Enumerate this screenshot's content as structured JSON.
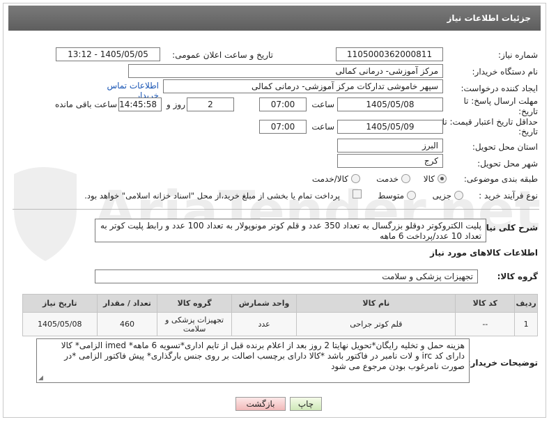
{
  "header": {
    "title": "جزئیات اطلاعات نیاز"
  },
  "watermark": {
    "text": "AriaTender.net"
  },
  "form": {
    "need_number_label": "شماره نیاز:",
    "need_number": "1105000362000811",
    "announce_label": "تاریخ و ساعت اعلان عمومی:",
    "announce_value": "1405/05/05 - 13:12",
    "buyer_org_label": "نام دستگاه خریدار:",
    "buyer_org": "مرکز آموزشی- درمانی کمالی",
    "creator_label": "ایجاد کننده درخواست:",
    "creator": "سپهر خاموشی تدارکات مرکز آموزشی- درمانی کمالی",
    "contact_link": "اطلاعات تماس خریدار",
    "reply_deadline_label": "مهلت ارسال پاسخ: تا تاریخ:",
    "reply_date": "1405/05/08",
    "time_label": "ساعت",
    "reply_time": "07:00",
    "days_label": "روز و",
    "days_value": "2",
    "remaining_time": "14:45:58",
    "remaining_label": "ساعت باقی مانده",
    "price_validity_label": "حداقل تاریخ اعتبار قیمت: تا تاریخ:",
    "price_date": "1405/05/09",
    "price_time": "07:00",
    "province_label": "استان محل تحویل:",
    "province": "البرز",
    "city_label": "شهر محل تحویل:",
    "city": "کرج",
    "category_label": "طبقه بندی موضوعی:",
    "category_options": [
      "کالا",
      "خدمت",
      "کالا/خدمت"
    ],
    "category_selected": "کالا",
    "process_label": "نوع فرآیند خرید :",
    "process_options": [
      "جزیی",
      "متوسط"
    ],
    "payment_note": "پرداخت تمام یا بخشی از مبلغ خرید،از محل \"اسناد خزانه اسلامی\" خواهد بود."
  },
  "summary": {
    "label": "شرح کلی نیاز:",
    "text": "پلیت الکتروکوتر دوقلو بزرگسال به تعداد 350 عدد و قلم کوتر مونوپولار به تعداد 100 عدد و رابط پلیت کوتر به تعداد 10 عدد/پرداخت 6 ماهه"
  },
  "goods": {
    "section_title": "اطلاعات کالاهای مورد نیاز",
    "group_label": "گروه کالا:",
    "group_value": "تجهیزات پزشکی و سلامت",
    "columns": [
      "ردیف",
      "کد کالا",
      "نام کالا",
      "واحد شمارش",
      "گروه کالا",
      "تعداد / مقدار",
      "تاریخ نیاز"
    ],
    "rows": [
      {
        "row": "1",
        "code": "--",
        "name": "قلم کوتر جراحی",
        "unit": "عدد",
        "group": "تجهیزات پزشکی و سلامت",
        "qty": "460",
        "date": "1405/05/08"
      }
    ]
  },
  "buyer_notes": {
    "label": "توضیحات خریدار:",
    "text": "هزینه حمل و تخلیه رایگان*تحویل نهایتا 2 روز بعد از اعلام برنده قبل از تایم اداری*تسویه 6 ماهه* imed الزامی* کالا دارای کد irc و لات نامبر در فاکتور باشد *کالا دارای برچسب اصالت بر روی جنس بارگذاری* پیش فاکتور الزامی *در صورت نامرغوب بودن مرجوع می شود"
  },
  "buttons": {
    "print": "چاپ",
    "back": "بازگشت"
  }
}
